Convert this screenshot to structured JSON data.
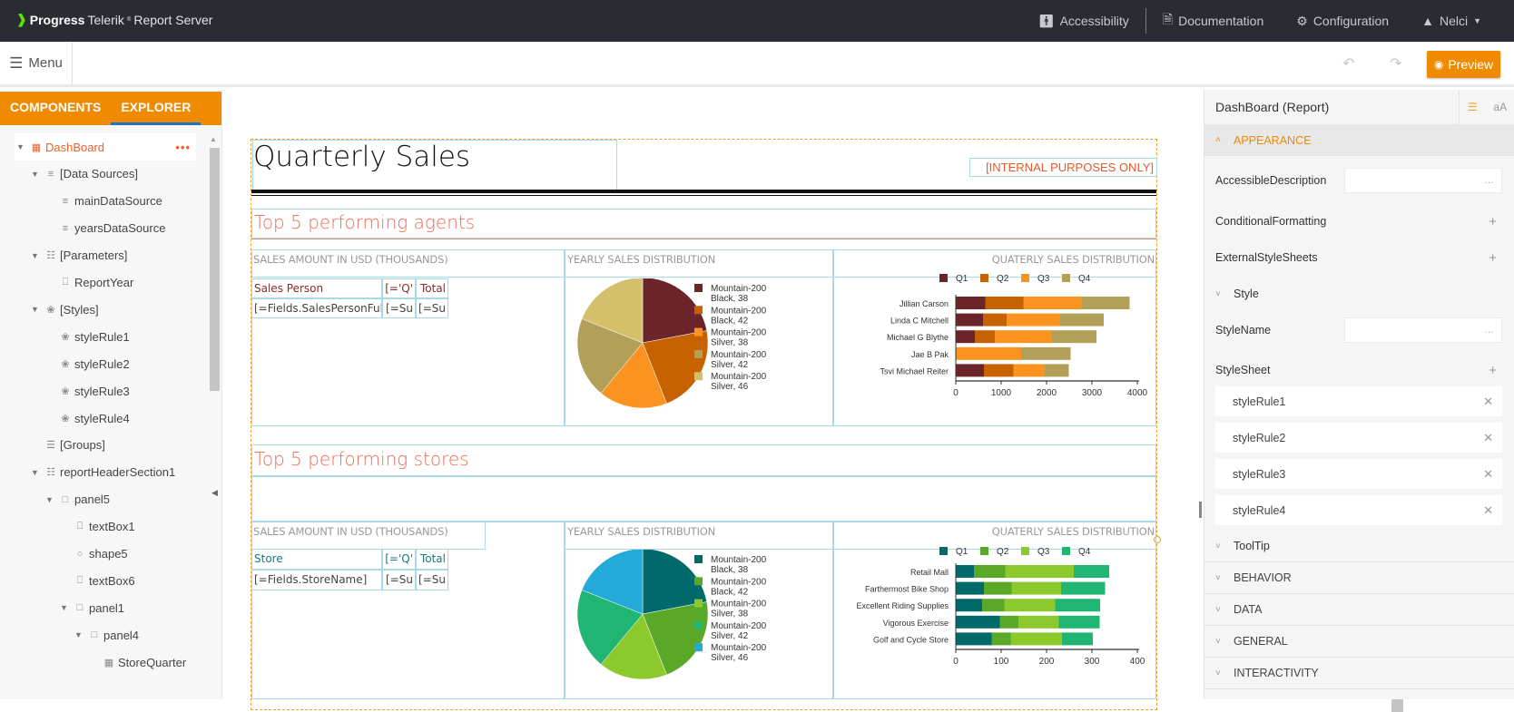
{
  "app": {
    "brand": "Progress",
    "product": "Telerik",
    "product_suffix": "Report Server"
  },
  "topnav": [
    {
      "icon": "accessibility-icon",
      "glyph": "ᾜD",
      "label": "Accessibility"
    },
    {
      "icon": "document-icon",
      "glyph": "☰",
      "label": "Documentation"
    },
    {
      "icon": "gear-icon",
      "glyph": "⚙",
      "label": "Configuration"
    },
    {
      "icon": "user-icon",
      "glyph": "☺",
      "label": "Nelci"
    }
  ],
  "toolbar": {
    "menu_label": "Menu",
    "preview_label": "Preview"
  },
  "left_panel": {
    "tabs": [
      {
        "label": "COMPONENTS",
        "active": false
      },
      {
        "label": "EXPLORER",
        "active": true
      }
    ],
    "tree": [
      {
        "label": "DashBoard",
        "depth": 0,
        "expanded": true,
        "icon": "report-icon",
        "selected": true
      },
      {
        "label": "[Data Sources]",
        "depth": 1,
        "expanded": true,
        "icon": "database-icon"
      },
      {
        "label": "mainDataSource",
        "depth": 2,
        "icon": "csv-datasource-icon"
      },
      {
        "label": "yearsDataSource",
        "depth": 2,
        "icon": "csv-datasource-icon"
      },
      {
        "label": "[Parameters]",
        "depth": 1,
        "expanded": true,
        "icon": "parameters-icon"
      },
      {
        "label": "ReportYear",
        "depth": 2,
        "icon": "parameter-icon"
      },
      {
        "label": "[Styles]",
        "depth": 1,
        "expanded": true,
        "icon": "palette-icon"
      },
      {
        "label": "styleRule1",
        "depth": 2,
        "icon": "palette-icon"
      },
      {
        "label": "styleRule2",
        "depth": 2,
        "icon": "palette-icon"
      },
      {
        "label": "styleRule3",
        "depth": 2,
        "icon": "palette-icon"
      },
      {
        "label": "styleRule4",
        "depth": 2,
        "icon": "palette-icon"
      },
      {
        "label": "[Groups]",
        "depth": 1,
        "icon": "groups-icon"
      },
      {
        "label": "reportHeaderSection1",
        "depth": 1,
        "expanded": true,
        "icon": "section-icon"
      },
      {
        "label": "panel5",
        "depth": 2,
        "expanded": true,
        "icon": "panel-icon"
      },
      {
        "label": "textBox1",
        "depth": 3,
        "icon": "textbox-icon"
      },
      {
        "label": "shape5",
        "depth": 3,
        "icon": "shape-icon"
      },
      {
        "label": "textBox6",
        "depth": 3,
        "icon": "textbox-icon"
      },
      {
        "label": "panel1",
        "depth": 3,
        "expanded": true,
        "icon": "panel-icon"
      },
      {
        "label": "panel4",
        "depth": 4,
        "expanded": true,
        "icon": "panel-icon"
      },
      {
        "label": "StoreQuarter",
        "depth": 5,
        "icon": "table-icon"
      }
    ]
  },
  "report": {
    "title": "Quarterly Sales",
    "internal_label": "[INTERNAL PURPOSES ONLY]",
    "agents_section": {
      "heading": "Top 5 performing agents",
      "caption_table": "SALES AMOUNT IN USD (THOUSANDS)",
      "caption_pie": "YEARLY SALES DISTRIBUTION",
      "caption_bar": "QUATERLY SALES DISTRIBUTION",
      "table_header": [
        "Sales Person",
        "[='Q'",
        "Total"
      ],
      "table_row": [
        "[=Fields.SalesPersonFull",
        "[=Su",
        "[=Su"
      ]
    },
    "stores_section": {
      "heading": "Top 5 performing stores",
      "caption_table": "SALES AMOUNT IN USD (THOUSANDS)",
      "caption_pie": "YEARLY SALES DISTRIBUTION",
      "caption_bar": "QUATERLY SALES DISTRIBUTION",
      "table_header": [
        "Store",
        "[='Q'",
        "Total"
      ],
      "table_row": [
        "[=Fields.StoreName]",
        "[=Su",
        "[=Su"
      ]
    }
  },
  "chart_data": [
    {
      "id": "agents-pie",
      "type": "pie",
      "title": "YEARLY SALES DISTRIBUTION",
      "legend_position": "right",
      "categories": [
        "Mountain-200 Black, 38",
        "Mountain-200 Black, 42",
        "Mountain-200 Silver, 38",
        "Mountain-200 Silver, 42",
        "Mountain-200 Silver, 46"
      ],
      "values": [
        22,
        22,
        17,
        20,
        19
      ],
      "colors": [
        "#6b2528",
        "#c66300",
        "#fb9320",
        "#b3a058",
        "#d4bf6a"
      ]
    },
    {
      "id": "agents-bar",
      "type": "bar",
      "orientation": "horizontal",
      "stacked": true,
      "title": "QUATERLY SALES DISTRIBUTION",
      "legend_position": "top",
      "categories": [
        "Jillian  Carson",
        "Linda C Mitchell",
        "Michael G Blythe",
        "Jae B Pak",
        "Tsvi Michael Reiter"
      ],
      "series": [
        {
          "name": "Q1",
          "color": "#6b2528",
          "values": [
            650,
            600,
            420,
            0,
            620
          ]
        },
        {
          "name": "Q2",
          "color": "#c66300",
          "values": [
            840,
            520,
            440,
            0,
            650
          ]
        },
        {
          "name": "Q3",
          "color": "#fb9320",
          "values": [
            1280,
            1170,
            1250,
            1440,
            680
          ]
        },
        {
          "name": "Q4",
          "color": "#b3a058",
          "values": [
            1060,
            970,
            990,
            1090,
            540
          ]
        }
      ],
      "xlim": [
        0,
        4000
      ],
      "xticks": [
        0,
        1000,
        2000,
        3000,
        4000
      ]
    },
    {
      "id": "stores-pie",
      "type": "pie",
      "title": "YEARLY SALES DISTRIBUTION",
      "legend_position": "right",
      "categories": [
        "Mountain-200 Black, 38",
        "Mountain-200 Black, 42",
        "Mountain-200 Silver, 38",
        "Mountain-200 Silver, 42",
        "Mountain-200 Silver, 46"
      ],
      "values": [
        22,
        22,
        17,
        20,
        19
      ],
      "colors": [
        "#006a6a",
        "#5aa827",
        "#8cc92c",
        "#21b574",
        "#23aad8"
      ]
    },
    {
      "id": "stores-bar",
      "type": "bar",
      "orientation": "horizontal",
      "stacked": true,
      "title": "QUATERLY SALES DISTRIBUTION",
      "legend_position": "top",
      "categories": [
        "Retail Mall",
        "Farthermost Bike Shop",
        "Excellent Riding Supplies",
        "Vigorous Exercise",
        "Golf and Cycle Store"
      ],
      "series": [
        {
          "name": "Q1",
          "color": "#006a6a",
          "values": [
            40,
            62,
            58,
            97,
            79
          ]
        },
        {
          "name": "Q2",
          "color": "#5aa827",
          "values": [
            69,
            61,
            49,
            41,
            42
          ]
        },
        {
          "name": "Q3",
          "color": "#8cc92c",
          "values": [
            151,
            109,
            112,
            89,
            113
          ]
        },
        {
          "name": "Q4",
          "color": "#21b574",
          "values": [
            78,
            97,
            99,
            90,
            68
          ]
        }
      ],
      "xlim": [
        0,
        400
      ],
      "xticks": [
        0,
        100,
        200,
        300,
        400
      ]
    }
  ],
  "properties": {
    "title": "DashBoard (Report)",
    "categories": {
      "appearance": "APPEARANCE",
      "behavior": "BEHAVIOR",
      "data": "DATA",
      "general": "GENERAL",
      "interactivity": "INTERACTIVITY"
    },
    "rows": {
      "accessible_description": {
        "label": "AccessibleDescription",
        "value": "",
        "button": "…"
      },
      "conditional_formatting": {
        "label": "ConditionalFormatting"
      },
      "external_style_sheets": {
        "label": "ExternalStyleSheets"
      },
      "style": {
        "label": "Style"
      },
      "style_name": {
        "label": "StyleName",
        "value": "",
        "button": "…"
      },
      "style_sheet": {
        "label": "StyleSheet"
      },
      "tooltip": {
        "label": "ToolTip"
      }
    },
    "style_rules": [
      "styleRule1",
      "styleRule2",
      "styleRule3",
      "styleRule4"
    ]
  }
}
